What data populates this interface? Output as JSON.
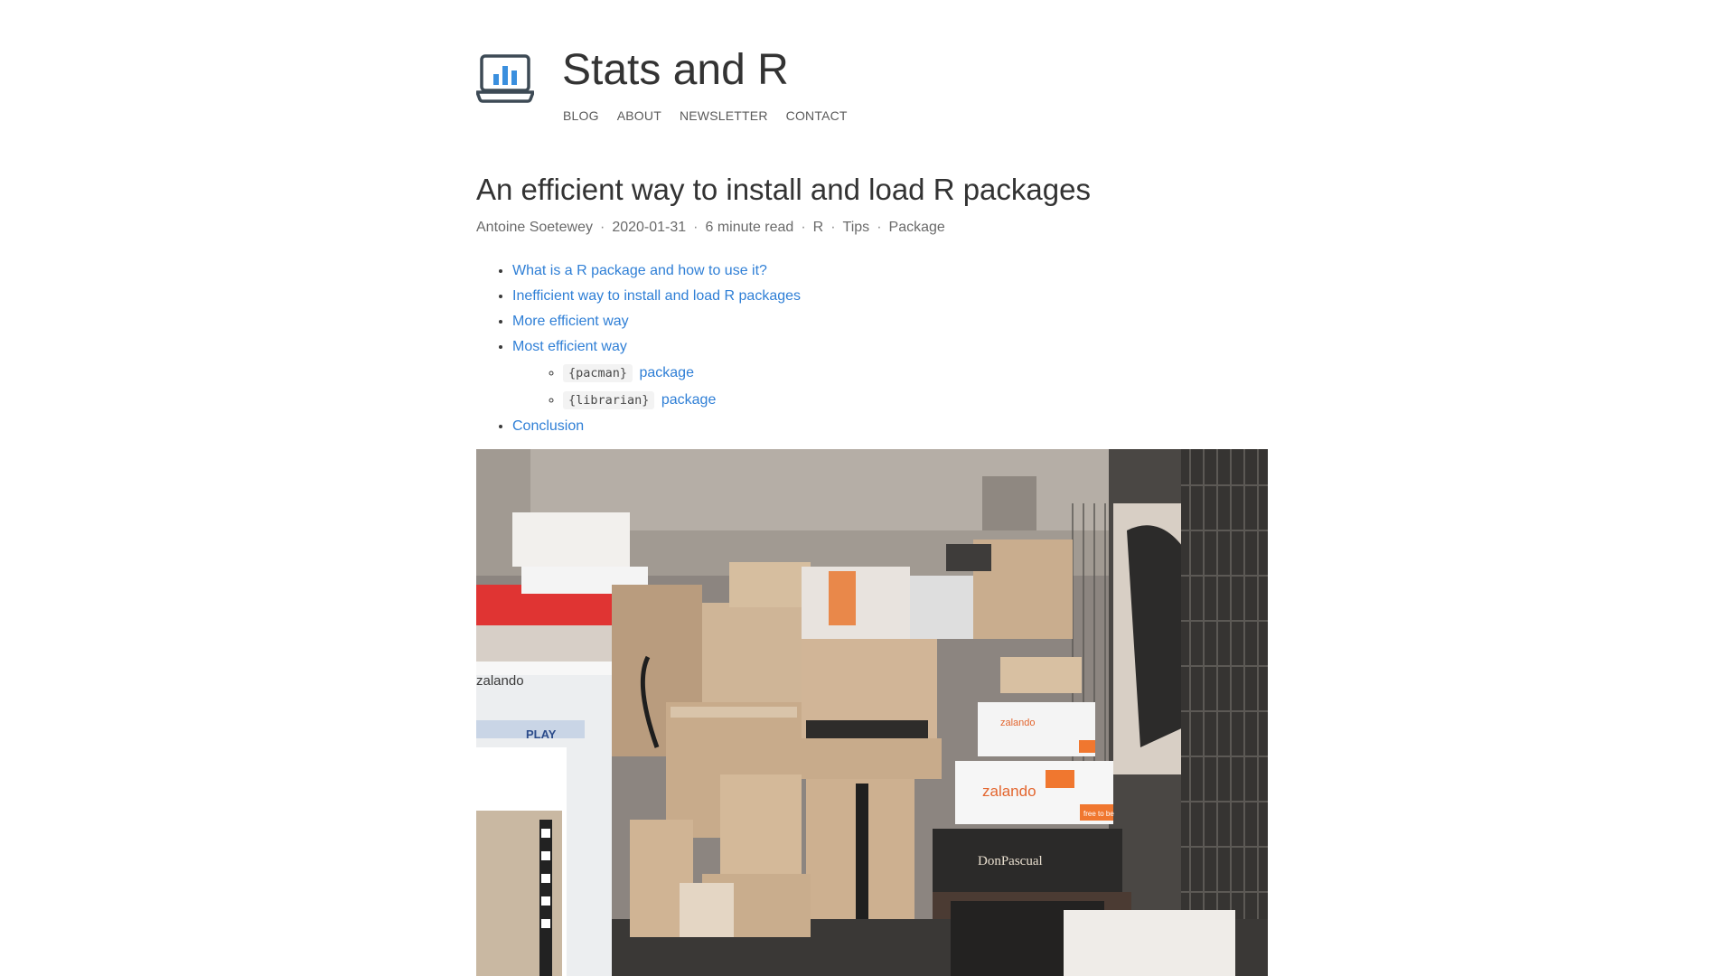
{
  "site": {
    "title": "Stats and R",
    "logo_icon": "laptop-chart-icon",
    "nav": [
      "BLOG",
      "ABOUT",
      "NEWSLETTER",
      "CONTACT"
    ]
  },
  "post": {
    "title": "An efficient way to install and load R packages",
    "meta": {
      "author": "Antoine Soetewey",
      "date": "2020-01-31",
      "read_time": "6 minute read",
      "tags": [
        "R",
        "Tips",
        "Package"
      ],
      "separator": "·"
    },
    "toc": {
      "items": [
        "What is a R package and how to use it?",
        "Inefficient way to install and load R packages",
        "More efficient way",
        "Most efficient way"
      ],
      "subitems": [
        {
          "code": "{pacman}",
          "label": "package"
        },
        {
          "code": "{librarian}",
          "label": "package"
        }
      ],
      "last_item": "Conclusion"
    },
    "hero_image": {
      "description_icon": "cardboard-boxes-photo",
      "box_labels": [
        "zalando",
        "zalando",
        "zalando",
        "DonPascual",
        "PLAY",
        "free to be",
        "free to be"
      ]
    }
  },
  "colors": {
    "link": "#2f7fd6",
    "title": "#333333",
    "meta": "#6a6a6a",
    "logo_bars": "#3a8fde"
  }
}
